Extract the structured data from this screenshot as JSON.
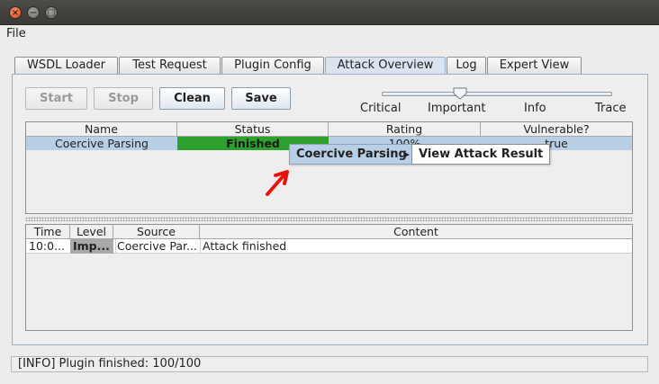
{
  "window": {
    "close_glyph": "×",
    "minimize_glyph": "−",
    "maximize_glyph": "□"
  },
  "menu": {
    "file": "File"
  },
  "tabs": [
    {
      "label": "WSDL Loader"
    },
    {
      "label": "Test Request"
    },
    {
      "label": "Plugin Config"
    },
    {
      "label": "Attack Overview",
      "active": true
    },
    {
      "label": "Log"
    },
    {
      "label": "Expert View"
    }
  ],
  "toolbar": {
    "start": "Start",
    "stop": "Stop",
    "clean": "Clean",
    "save": "Save"
  },
  "slider": {
    "levels": [
      "Critical",
      "Important",
      "Info",
      "Trace"
    ],
    "selected": "Important"
  },
  "attack_table": {
    "columns": [
      "Name",
      "Status",
      "Rating",
      "Vulnerable?"
    ],
    "rows": [
      {
        "name": "Coercive Parsing",
        "status": "Finished",
        "rating": "100%",
        "vulnerable": "true"
      }
    ]
  },
  "context_menu": {
    "parent": "Coercive Parsing",
    "submenu_arrow": "▸",
    "child": "View Attack Result"
  },
  "log_table": {
    "columns": [
      "Time",
      "Level",
      "Source",
      "Content"
    ],
    "rows": [
      {
        "time": "10:0...",
        "level": "Imp...",
        "source": "Coercive Par...",
        "content": "Attack finished"
      }
    ]
  },
  "status_bar": "[INFO] Plugin finished: 100/100",
  "colors": {
    "row_selected": "#b8cfe5",
    "status_finished": "#2ea02e",
    "accent": "#d9e4ef",
    "arrow_cursor": "#e8120c"
  }
}
